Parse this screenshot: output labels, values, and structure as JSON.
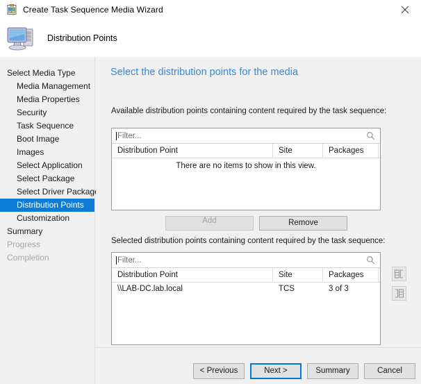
{
  "window": {
    "title": "Create Task Sequence Media Wizard",
    "icon": "task-sequence-wizard-icon",
    "close_label": "close-icon"
  },
  "header": {
    "title": "Distribution Points",
    "icon": "computer-icon"
  },
  "sidebar": {
    "items": [
      {
        "label": "Select Media Type",
        "indent": false,
        "state": "normal"
      },
      {
        "label": "Media Management",
        "indent": true,
        "state": "normal"
      },
      {
        "label": "Media Properties",
        "indent": true,
        "state": "normal"
      },
      {
        "label": "Security",
        "indent": true,
        "state": "normal"
      },
      {
        "label": "Task Sequence",
        "indent": true,
        "state": "normal"
      },
      {
        "label": "Boot Image",
        "indent": true,
        "state": "normal"
      },
      {
        "label": "Images",
        "indent": true,
        "state": "normal"
      },
      {
        "label": "Select Application",
        "indent": true,
        "state": "normal"
      },
      {
        "label": "Select Package",
        "indent": true,
        "state": "normal"
      },
      {
        "label": "Select Driver Package",
        "indent": true,
        "state": "normal"
      },
      {
        "label": "Distribution Points",
        "indent": true,
        "state": "selected"
      },
      {
        "label": "Customization",
        "indent": true,
        "state": "normal"
      },
      {
        "label": "Summary",
        "indent": false,
        "state": "normal"
      },
      {
        "label": "Progress",
        "indent": false,
        "state": "disabled"
      },
      {
        "label": "Completion",
        "indent": false,
        "state": "disabled"
      }
    ]
  },
  "main": {
    "heading": "Select the distribution points for the media",
    "available": {
      "label": "Available distribution points containing content required by the task sequence:",
      "filter_value": "",
      "filter_placeholder": "Filter...",
      "search_icon": "search-icon",
      "columns": [
        "Distribution Point",
        "Site",
        "Packages"
      ],
      "rows": [],
      "empty_message": "There are no items to show in this view."
    },
    "selected": {
      "label": "Selected distribution points containing content required by the task sequence:",
      "filter_value": "",
      "filter_placeholder": "Filter...",
      "search_icon": "search-icon",
      "columns": [
        "Distribution Point",
        "Site",
        "Packages"
      ],
      "rows": [
        {
          "dp": "\\\\LAB-DC.lab.local",
          "site": "TCS",
          "packages": "3 of 3"
        }
      ]
    },
    "add_label": "Add",
    "remove_label": "Remove",
    "side_buttons": [
      {
        "icon": "move-content-right-icon"
      },
      {
        "icon": "move-content-left-icon"
      }
    ]
  },
  "footer": {
    "previous_label": "< Previous",
    "next_label": "Next >",
    "summary_label": "Summary",
    "cancel_label": "Cancel"
  },
  "colors": {
    "selection_blue": "#0c7cd5",
    "heading_blue": "#3a87d4",
    "focus_blue": "#0078d7",
    "window_bg": "#f0f0f0",
    "list_bg": "#ffffff"
  }
}
